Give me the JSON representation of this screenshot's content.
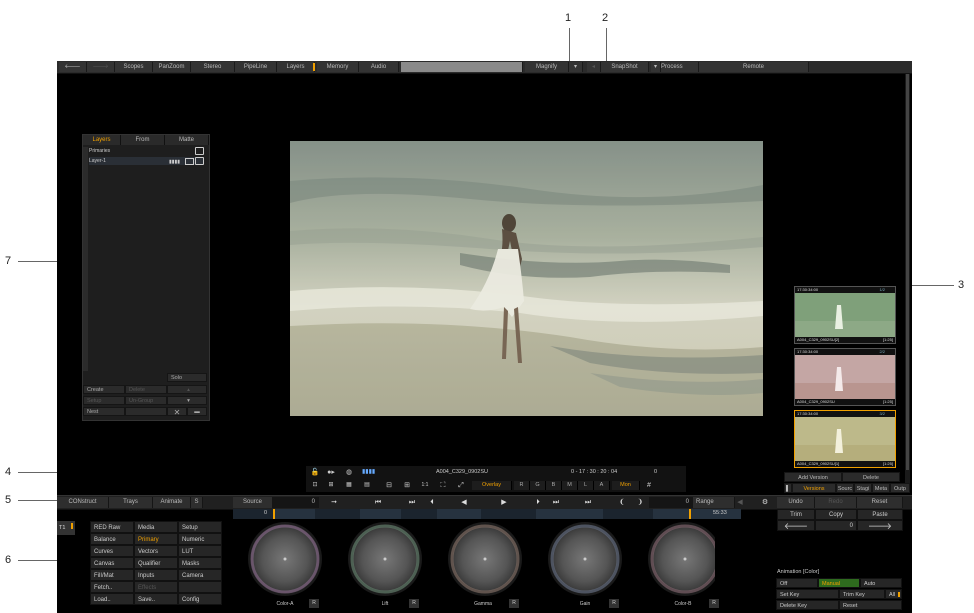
{
  "callouts": [
    "1",
    "2",
    "3",
    "4",
    "5",
    "6",
    "7"
  ],
  "topbar": {
    "items": [
      "Scopes",
      "PanZoom",
      "Stereo",
      "PipeLine",
      "Layers",
      "Memory",
      "Audio",
      "Magnify",
      "SnapShot",
      "Process",
      "Remote"
    ]
  },
  "layers_panel": {
    "tabs": [
      "Layers",
      "From",
      "Matte"
    ],
    "rows": [
      "Primaries",
      "Layer-1"
    ],
    "solo": "Solo",
    "buttons": [
      "Create",
      "Delete",
      "Setup",
      "Un-Group",
      "Nest"
    ]
  },
  "thumbnails": [
    {
      "timecode": "17:30:34:00",
      "tag": "1/2",
      "clip": "A004_C329_0902SU[2]",
      "count": "[1:25]"
    },
    {
      "timecode": "17:30:34:00",
      "tag": "2/2",
      "clip": "A004_C329_0902SU",
      "count": "[1:25]"
    },
    {
      "timecode": "17:30:34:00",
      "tag": "3/2",
      "clip": "A004_C329_0902SU[1]",
      "count": "[1:25]"
    }
  ],
  "version_panel": {
    "add": "Add Version",
    "delete": "Delete",
    "tabs": [
      "Versions",
      "Sourc",
      "Stagi",
      "Meta",
      "Outp"
    ]
  },
  "infobar": {
    "clip_name": "A004_C329_0902SU",
    "timecode": "0  -  17 : 30 : 20 : 04",
    "frame": "0",
    "buttons": [
      "Overlay",
      "R",
      "G",
      "B",
      "M",
      "L",
      "A",
      "Mon"
    ]
  },
  "transport": {
    "left_items": [
      "CONstruct",
      "Trays",
      "Animate",
      "S"
    ],
    "source": "Source",
    "source_value": "0",
    "range_value": "0",
    "range": "Range",
    "right_items": [
      "Undo",
      "Redo",
      "Reset"
    ],
    "timeline_start": "0",
    "timeline_end": "55:33"
  },
  "track": "T1",
  "menu": [
    [
      "RED Raw",
      "Media",
      "Setup"
    ],
    [
      "Balance",
      "Primary",
      "Numeric"
    ],
    [
      "Curves",
      "Vectors",
      "LUT"
    ],
    [
      "Canvas",
      "Qualifier",
      "Masks"
    ],
    [
      "FilI/Mat",
      "Inputs",
      "Camera"
    ],
    [
      "Fetch..",
      "Effects",
      ""
    ],
    [
      "Load..",
      "Save..",
      "Config"
    ]
  ],
  "wheels": [
    "Color-A",
    "Lift",
    "Gamma",
    "Gain",
    "Color-B"
  ],
  "wheel_reset": "R",
  "edit_buttons": {
    "trim": "Trim",
    "copy": "Copy",
    "paste": "Paste",
    "value": "0"
  },
  "animation": {
    "title": "Animation [Color]",
    "modes": [
      "Off",
      "Manual",
      "Auto"
    ],
    "row2": [
      "Set Key",
      "Trim Key",
      "All"
    ],
    "row3": [
      "Delete Key",
      "Reset"
    ]
  },
  "colors": {
    "accent": "#f0a000",
    "background": "#000000",
    "panel": "#262626"
  }
}
